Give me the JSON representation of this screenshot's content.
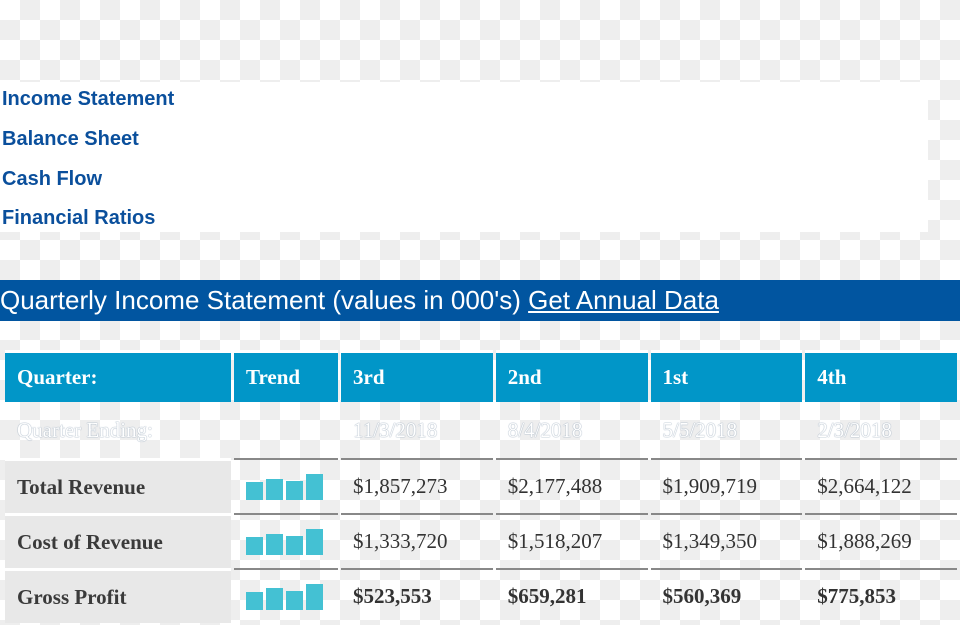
{
  "nav": [
    "Income Statement",
    "Balance Sheet",
    "Cash Flow",
    "Financial Ratios"
  ],
  "banner": {
    "title": "Quarterly Income Statement (values in 000's)",
    "link": "Get Annual Data"
  },
  "table": {
    "headers": [
      "Quarter:",
      "Trend",
      "3rd",
      "2nd",
      "1st",
      "4th"
    ],
    "ending_label": "Quarter Ending:",
    "endings": [
      "11/3/2018",
      "8/4/2018",
      "5/5/2018",
      "2/3/2018"
    ],
    "rows": [
      {
        "label": "Total Revenue",
        "values": [
          "$1,857,273",
          "$2,177,488",
          "$1,909,719",
          "$2,664,122"
        ],
        "trend": [
          1857273,
          2177488,
          1909719,
          2664122
        ],
        "bold": false
      },
      {
        "label": "Cost of Revenue",
        "values": [
          "$1,333,720",
          "$1,518,207",
          "$1,349,350",
          "$1,888,269"
        ],
        "trend": [
          1333720,
          1518207,
          1349350,
          1888269
        ],
        "bold": false
      },
      {
        "label": "Gross Profit",
        "values": [
          "$523,553",
          "$659,281",
          "$560,369",
          "$775,853"
        ],
        "trend": [
          523553,
          659281,
          560369,
          775853
        ],
        "bold": true
      }
    ]
  },
  "colors": {
    "link": "#0a4f9c",
    "banner": "#0155a0",
    "header": "#0196c8",
    "trend_bar": "#44c1d3"
  }
}
